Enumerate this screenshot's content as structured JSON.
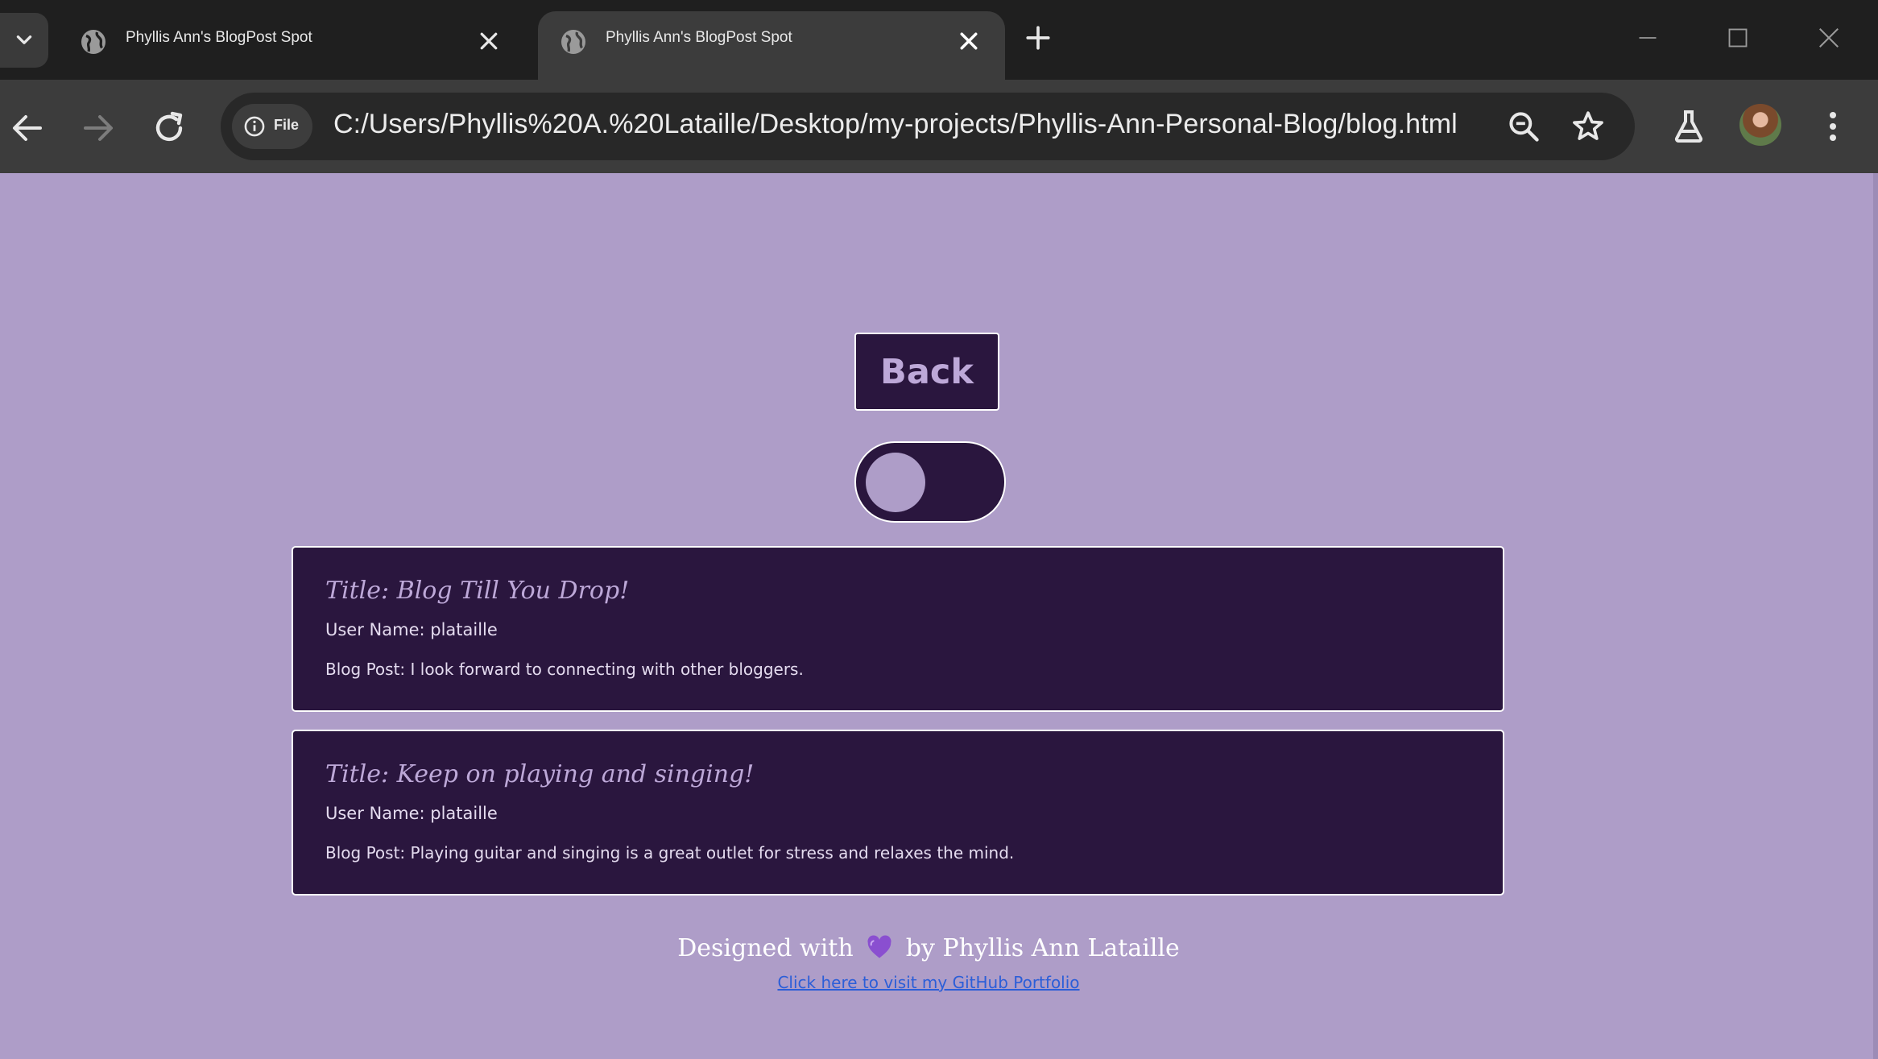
{
  "browser": {
    "tabs": [
      {
        "title": "Phyllis Ann's BlogPost Spot",
        "active": false
      },
      {
        "title": "Phyllis Ann's BlogPost Spot",
        "active": true
      }
    ],
    "address_bar": {
      "chip_label": "File",
      "url": "C:/Users/Phyllis%20A.%20Lataille/Desktop/my-projects/Phyllis-Ann-Personal-Blog/blog.html"
    },
    "icons": {
      "tab_search": "chevron-down-icon",
      "tab_favicon": "globe-icon",
      "tab_close": "close-icon",
      "new_tab": "plus-icon",
      "minimize": "minimize-icon",
      "maximize": "maximize-icon",
      "close_window": "close-icon",
      "back": "arrow-left-icon",
      "forward": "arrow-right-icon",
      "reload": "reload-icon",
      "site_info": "info-icon",
      "zoom": "zoom-out-icon",
      "bookmark": "star-icon",
      "labs": "flask-icon",
      "menu": "kebab-menu-icon"
    }
  },
  "page": {
    "background_color": "#ae9dc8",
    "card_color": "#2a163e",
    "back_button_label": "Back",
    "theme_toggle": {
      "state": "off"
    },
    "posts": [
      {
        "title": "Title: Blog Till You Drop!",
        "user": "User Name: plataille",
        "body": "Blog Post: I look forward to connecting with other bloggers."
      },
      {
        "title": "Title: Keep on playing and singing!",
        "user": "User Name: plataille",
        "body": "Blog Post: Playing guitar and singing is a great outlet for stress and relaxes the mind."
      }
    ],
    "footer": {
      "credit_prefix": "Designed with",
      "credit_suffix": "by Phyllis Ann Lataille",
      "heart_icon": "purple-heart-icon",
      "link_text": "Click here to visit my GitHub Portfolio"
    }
  }
}
